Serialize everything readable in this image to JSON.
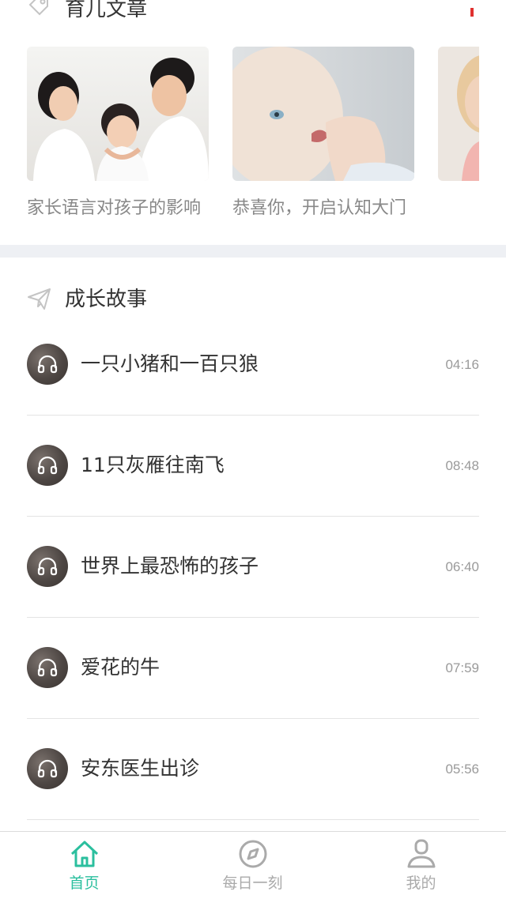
{
  "articles": {
    "title": "育儿文章",
    "items": [
      {
        "title": "家长语言对孩子的影响",
        "image": "family-photo"
      },
      {
        "title": "恭喜你，开启认知大门",
        "image": "baby-photo"
      },
      {
        "title": "",
        "image": "child-photo"
      }
    ]
  },
  "stories": {
    "title": "成长故事",
    "items": [
      {
        "title": "一只小猪和一百只狼",
        "duration": "04:16"
      },
      {
        "title": "11只灰雁往南飞",
        "duration": "08:48"
      },
      {
        "title": "世界上最恐怖的孩子",
        "duration": "06:40"
      },
      {
        "title": "爱花的牛",
        "duration": "07:59"
      },
      {
        "title": "安东医生出诊",
        "duration": "05:56"
      }
    ]
  },
  "tabbar": {
    "tabs": [
      {
        "label": "首页",
        "icon": "home-icon",
        "active": true
      },
      {
        "label": "每日一刻",
        "icon": "compass-icon",
        "active": false
      },
      {
        "label": "我的",
        "icon": "user-icon",
        "active": false
      }
    ],
    "active_color": "#2bbf9e",
    "inactive_color": "#aaaaaa"
  },
  "colors": {
    "accent": "#2bbf9e",
    "red_marker": "#e0312f",
    "section_divider": "#eef0f4"
  }
}
